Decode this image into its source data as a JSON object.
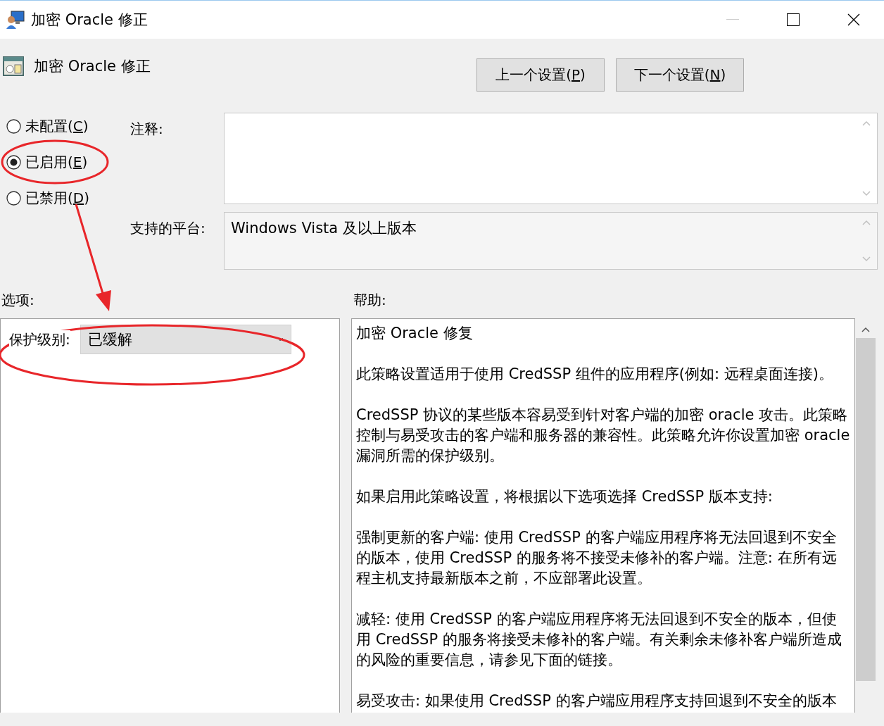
{
  "window": {
    "title": "加密 Oracle 修正"
  },
  "header": {
    "title": "加密 Oracle 修正"
  },
  "nav_buttons": [
    {
      "label": "上一个设置(P)"
    },
    {
      "label": "下一个设置(N)"
    }
  ],
  "state_radios": [
    {
      "label": "未配置(C)",
      "selected": false
    },
    {
      "label": "已启用(E)",
      "selected": true
    },
    {
      "label": "已禁用(D)",
      "selected": false
    }
  ],
  "comment": {
    "label": "注释:"
  },
  "platform": {
    "label": "支持的平台:",
    "value": "Windows Vista 及以上版本"
  },
  "options": {
    "heading": "选项:",
    "field_label": "保护级别:",
    "dropdown_value": "已缓解"
  },
  "help": {
    "heading": "帮助:",
    "paragraphs": [
      "加密 Oracle 修复",
      "此策略设置适用于使用 CredSSP 组件的应用程序(例如: 远程桌面连接)。",
      "CredSSP 协议的某些版本容易受到针对客户端的加密 oracle 攻击。此策略控制与易受攻击的客户端和服务器的兼容性。此策略允许你设置加密 oracle 漏洞所需的保护级别。",
      "如果启用此策略设置，将根据以下选项选择 CredSSP 版本支持:",
      "强制更新的客户端: 使用 CredSSP 的客户端应用程序将无法回退到不安全的版本，使用 CredSSP 的服务将不接受未修补的客户端。注意: 在所有远程主机支持最新版本之前，不应部署此设置。",
      "减轻: 使用 CredSSP 的客户端应用程序将无法回退到不安全的版本，但使用 CredSSP 的服务将接受未修补的客户端。有关剩余未修补客户端所造成的风险的重要信息，请参见下面的链接。",
      "易受攻击: 如果使用 CredSSP 的客户端应用程序支持回退到不安全的版本"
    ]
  }
}
